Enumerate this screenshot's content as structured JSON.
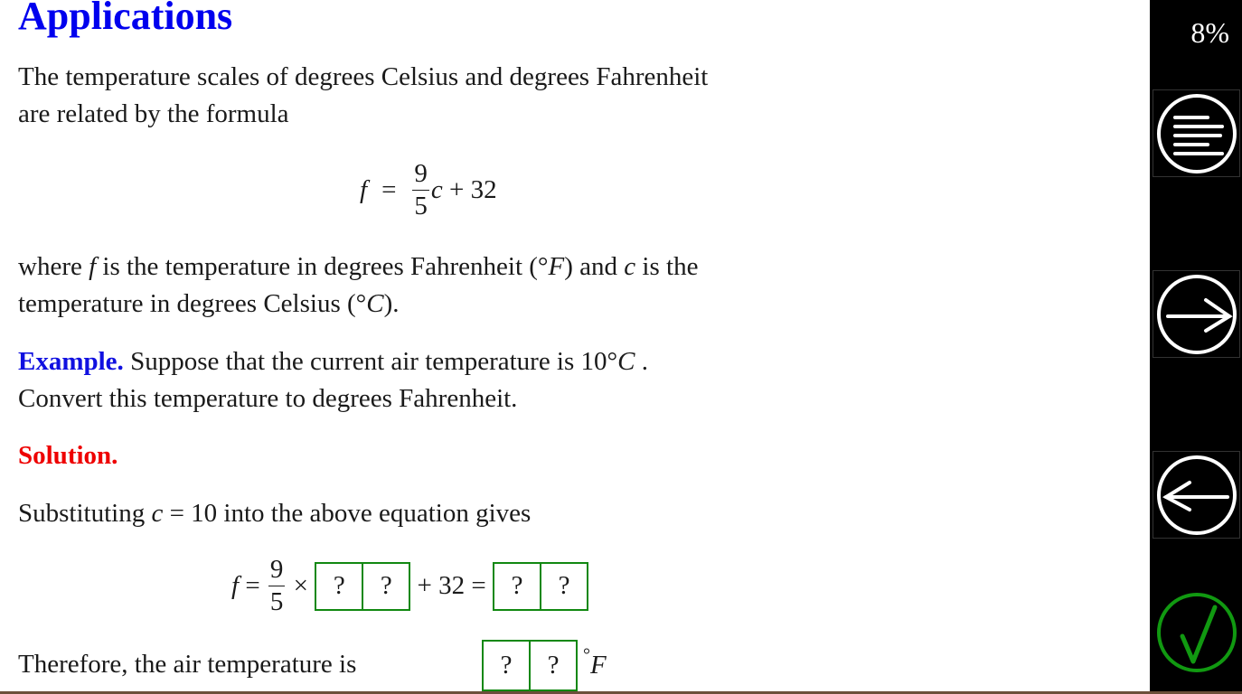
{
  "page": {
    "title": "Applications",
    "intro_line1": "The temperature scales of degrees Celsius and degrees Fahrenheit",
    "intro_line2": "are related by the formula",
    "formula": {
      "lhs": "f",
      "eq": "=",
      "num": "9",
      "den": "5",
      "rest_var": "c",
      "rest": " + 32"
    },
    "where_line1_a": "where ",
    "where_line1_f": "f",
    "where_line1_b": " is the temperature in degrees Fahrenheit (°",
    "where_line1_F": "F",
    "where_line1_c1": ") and ",
    "where_line1_c": "c",
    "where_line1_d": " is the",
    "where_line2_a": "temperature in degrees Celsius (°",
    "where_line2_C": "C",
    "where_line2_b": ").",
    "example_label": "Example.",
    "example_text1": " Suppose that the current air temperature is 10°",
    "example_C": "C",
    "example_text1_end": " .",
    "example_text2": "Convert this temperature to degrees Fahrenheit.",
    "solution_label": "Solution.",
    "subst_a": "Substituting ",
    "subst_c": "c",
    "subst_b": " = 10 into the above equation gives",
    "calc": {
      "lhs": "f",
      "eq": " = ",
      "num": "9",
      "den": "5",
      "times": " × ",
      "plus": " + 32 = ",
      "boxes1": [
        "?",
        "?"
      ],
      "boxes2": [
        "?",
        "?"
      ]
    },
    "answer_text": "Therefore, the air temperature is",
    "answer_boxes": [
      "?",
      "?"
    ],
    "answer_unit_deg": "°",
    "answer_unit_F": "F"
  },
  "sidebar": {
    "progress": "8%",
    "buttons": [
      {
        "name": "contents",
        "icon": "menu-lines-icon"
      },
      {
        "name": "next",
        "icon": "arrow-right-icon"
      },
      {
        "name": "previous",
        "icon": "arrow-left-icon"
      },
      {
        "name": "check",
        "icon": "checkmark-icon"
      }
    ]
  },
  "colors": {
    "title": "#0000ee",
    "example": "#1010e0",
    "solution": "#ee0000",
    "box_border": "#118811",
    "check": "#119911"
  }
}
